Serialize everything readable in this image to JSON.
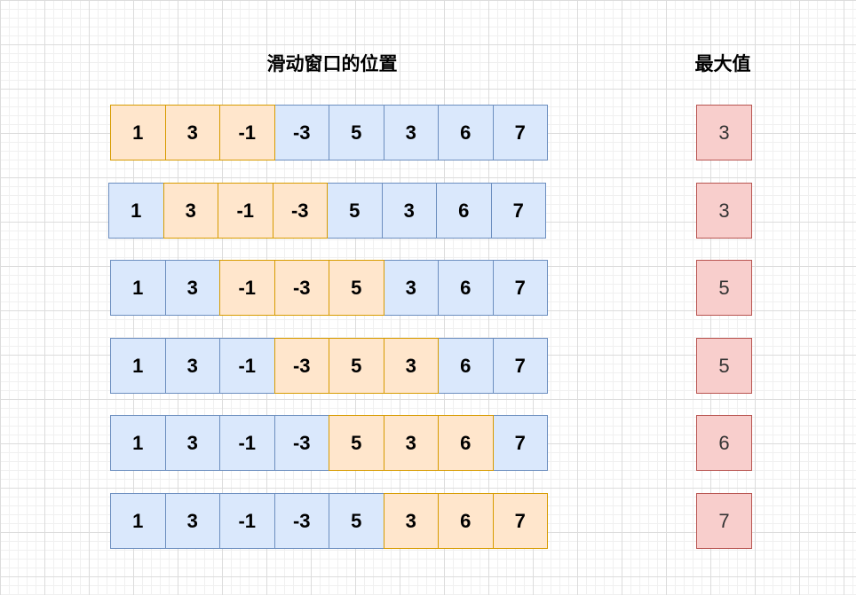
{
  "headers": {
    "window_position": "滑动窗口的位置",
    "max_value": "最大值"
  },
  "array": [
    "1",
    "3",
    "-1",
    "-3",
    "5",
    "3",
    "6",
    "7"
  ],
  "window_size": 3,
  "steps": [
    {
      "window_start": 0,
      "max": "3"
    },
    {
      "window_start": 1,
      "max": "3"
    },
    {
      "window_start": 2,
      "max": "5"
    },
    {
      "window_start": 3,
      "max": "5"
    },
    {
      "window_start": 4,
      "max": "6"
    },
    {
      "window_start": 5,
      "max": "7"
    }
  ],
  "colors": {
    "outside_fill": "#dae8fc",
    "outside_stroke": "#6c8ebf",
    "window_fill": "#ffe6cc",
    "window_stroke": "#d79b00",
    "max_fill": "#f8cecc",
    "max_stroke": "#b85450"
  }
}
